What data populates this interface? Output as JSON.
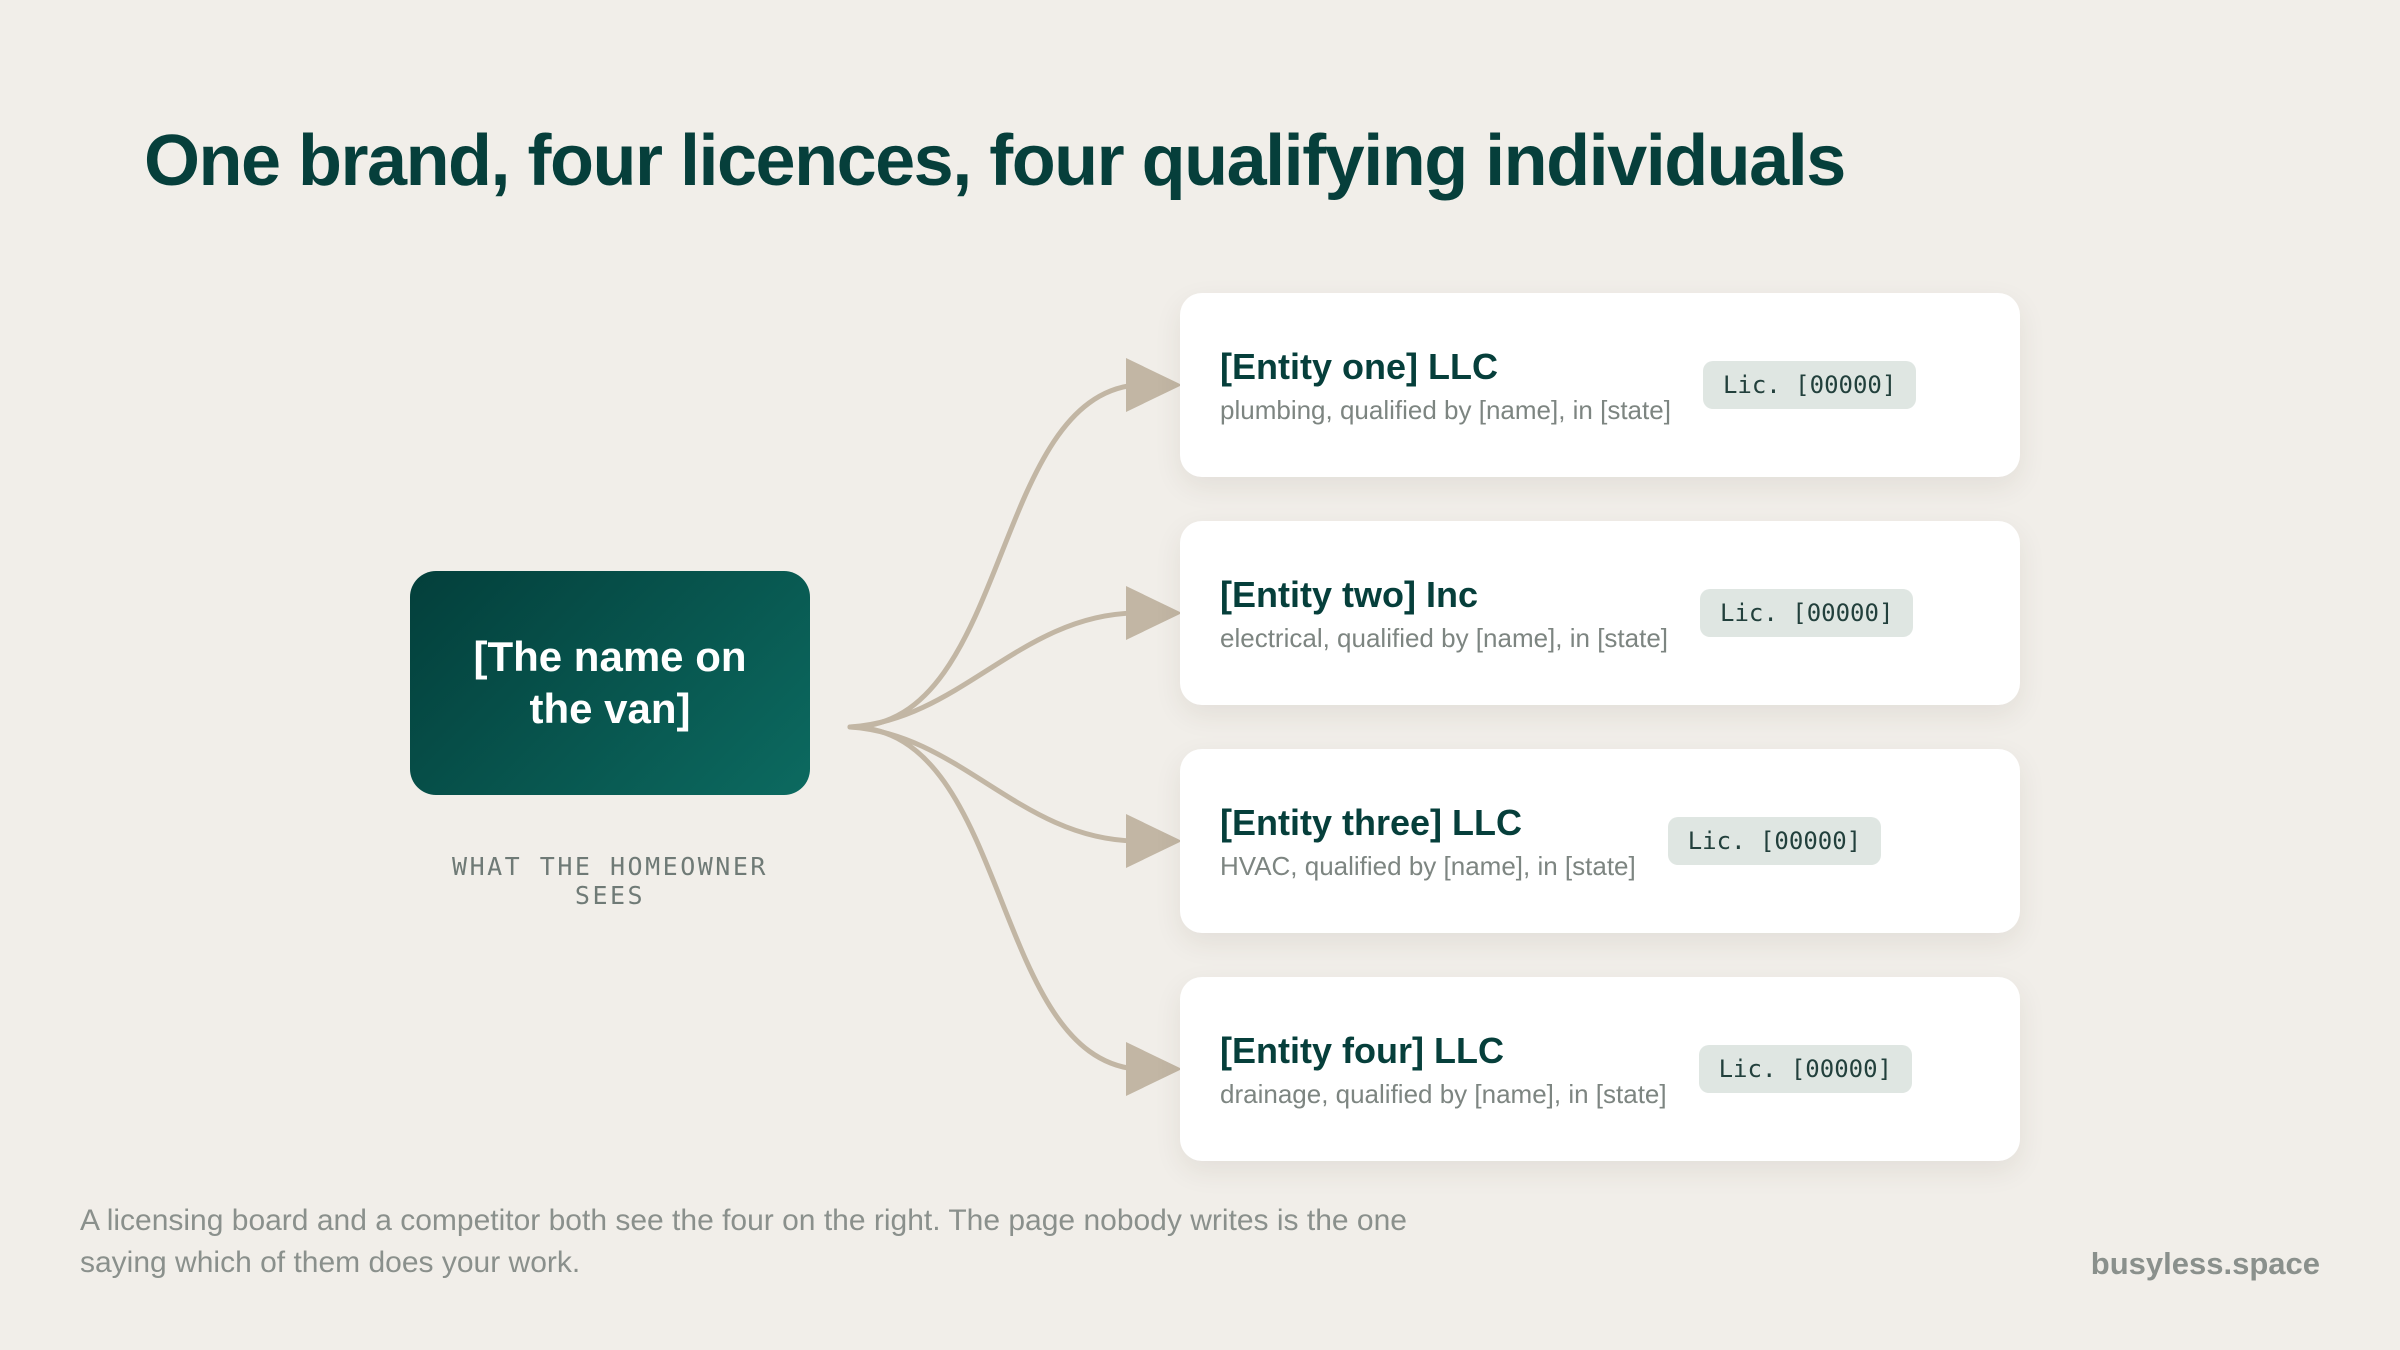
{
  "title": "One brand, four licences, four qualifying individuals",
  "brand": {
    "label": "[The name on the van]",
    "caption": "WHAT THE HOMEOWNER SEES"
  },
  "entities": [
    {
      "name": "[Entity one] LLC",
      "detail": "plumbing, qualified by [name], in [state]",
      "licence": "Lic. [00000]"
    },
    {
      "name": "[Entity two] Inc",
      "detail": "electrical, qualified by [name], in [state]",
      "licence": "Lic. [00000]"
    },
    {
      "name": "[Entity three] LLC",
      "detail": "HVAC, qualified by [name], in [state]",
      "licence": "Lic. [00000]"
    },
    {
      "name": "[Entity four] LLC",
      "detail": "drainage, qualified by [name], in [state]",
      "licence": "Lic. [00000]"
    }
  ],
  "footer": {
    "note": "A licensing board and a competitor both see the four on the right. The page nobody writes is the one saying which of them does your work.",
    "site": "busyless.space"
  },
  "colors": {
    "background": "#f1eee9",
    "accent": "#063f3b",
    "arrow": "#c2b6a4"
  }
}
